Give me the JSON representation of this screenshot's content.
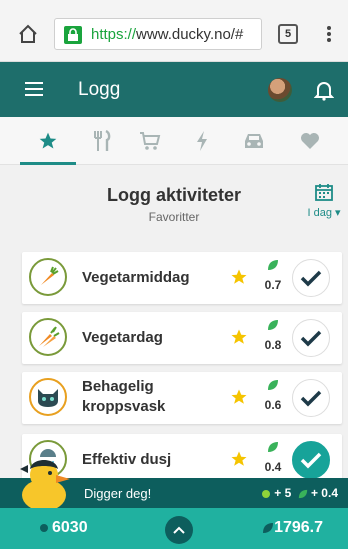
{
  "browser": {
    "url_scheme": "https://",
    "url_rest": "www.ducky.no/#",
    "tab_count": "5"
  },
  "appbar": {
    "title": "Logg"
  },
  "category_tabs": [
    {
      "name": "star-icon"
    },
    {
      "name": "cutlery-icon"
    },
    {
      "name": "cart-icon"
    },
    {
      "name": "lightning-icon"
    },
    {
      "name": "car-icon"
    },
    {
      "name": "heart-icon"
    }
  ],
  "section": {
    "title": "Logg aktiviteter",
    "subtitle": "Favoritter",
    "date_label": "I dag ▾"
  },
  "activities": [
    {
      "name": "Vegetarmiddag",
      "value": "0.7",
      "checked": false,
      "icon": "carrot-icon"
    },
    {
      "name": "Vegetardag",
      "value": "0.8",
      "checked": false,
      "icon": "carrots-icon"
    },
    {
      "name": "Behagelig kroppsvask",
      "value": "0.6",
      "checked": false,
      "icon": "cat-icon"
    },
    {
      "name": "Effektiv dusj",
      "value": "0.4",
      "checked": true,
      "icon": "shower-icon"
    }
  ],
  "banner": {
    "message": "Digger deg!",
    "points": "+ 5",
    "leaf_points": "+ 0.4"
  },
  "footer": {
    "left_value": "6030",
    "right_value": "1796.7"
  },
  "colors": {
    "teal_dark": "#1e6e6b",
    "teal_bright": "#20b1a0",
    "star": "#f5c400",
    "leaf": "#39b25a"
  }
}
